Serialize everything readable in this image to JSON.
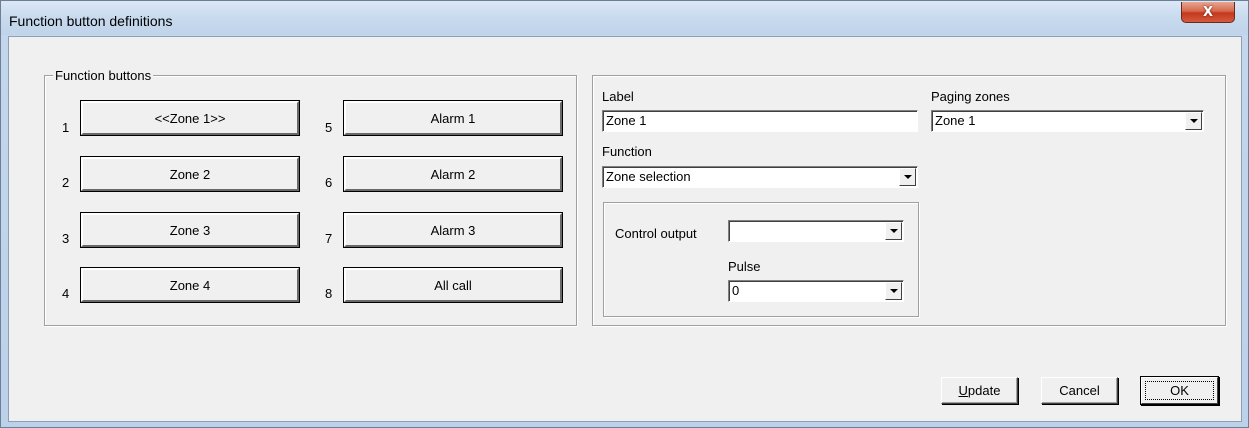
{
  "window": {
    "title": "Function button definitions",
    "close_glyph": "X"
  },
  "function_buttons": {
    "legend": "Function buttons",
    "items": [
      {
        "num": "1",
        "label": "<<Zone 1>>"
      },
      {
        "num": "2",
        "label": "Zone 2"
      },
      {
        "num": "3",
        "label": "Zone 3"
      },
      {
        "num": "4",
        "label": "Zone 4"
      },
      {
        "num": "5",
        "label": "Alarm 1"
      },
      {
        "num": "6",
        "label": "Alarm 2"
      },
      {
        "num": "7",
        "label": "Alarm 3"
      },
      {
        "num": "8",
        "label": "All call"
      }
    ]
  },
  "details": {
    "label_caption": "Label",
    "label_value": "Zone 1",
    "paging_caption": "Paging zones",
    "paging_value": "Zone 1",
    "function_caption": "Function",
    "function_value": "Zone selection",
    "control_output_caption": "Control output",
    "control_output_value": "",
    "pulse_caption": "Pulse",
    "pulse_value": "0"
  },
  "buttons": {
    "update_label": "Update",
    "update_mnemonic": "U",
    "update_rest": "pdate",
    "cancel_label": "Cancel",
    "ok_label": "OK"
  }
}
